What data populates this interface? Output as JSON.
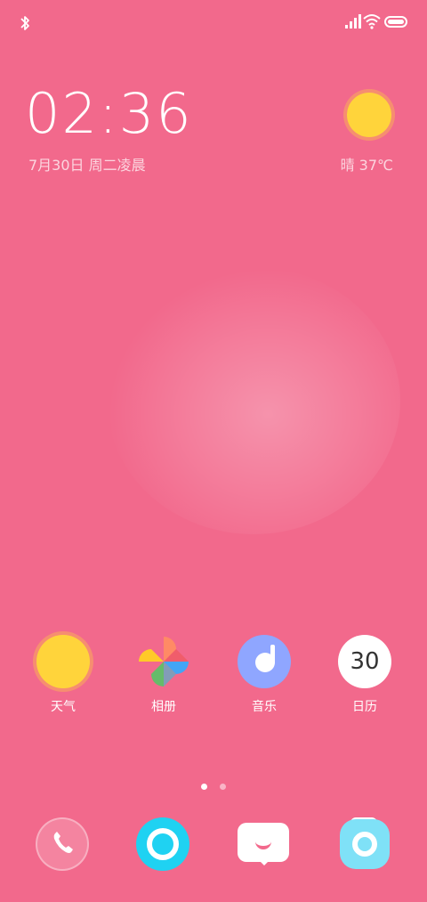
{
  "status_bar": {
    "bluetooth_icon": "bluetooth-icon",
    "signal_icon": "signal-icon",
    "wifi_icon": "wifi-icon",
    "battery_icon": "battery-icon"
  },
  "clock_widget": {
    "time": "02:36",
    "date": "7月30日  周二凌晨",
    "weather_text": "晴  37℃",
    "weather_icon": "sun-icon"
  },
  "apps": [
    {
      "label": "天气",
      "icon": "weather-sun-icon"
    },
    {
      "label": "相册",
      "icon": "photos-pinwheel-icon"
    },
    {
      "label": "音乐",
      "icon": "music-note-icon"
    },
    {
      "label": "日历",
      "icon": "calendar-icon",
      "day": "30"
    }
  ],
  "page_indicator": {
    "pages": 2,
    "current": 1
  },
  "dock": [
    {
      "name": "phone",
      "icon": "phone-icon"
    },
    {
      "name": "browser",
      "icon": "browser-icon"
    },
    {
      "name": "messages",
      "icon": "message-icon"
    },
    {
      "name": "camera",
      "icon": "camera-icon"
    }
  ],
  "colors": {
    "background": "#f2698c",
    "sun": "#ffd43b",
    "music": "#8fa6ff",
    "browser": "#1fd2f2",
    "camera": "#7fe1f7"
  }
}
